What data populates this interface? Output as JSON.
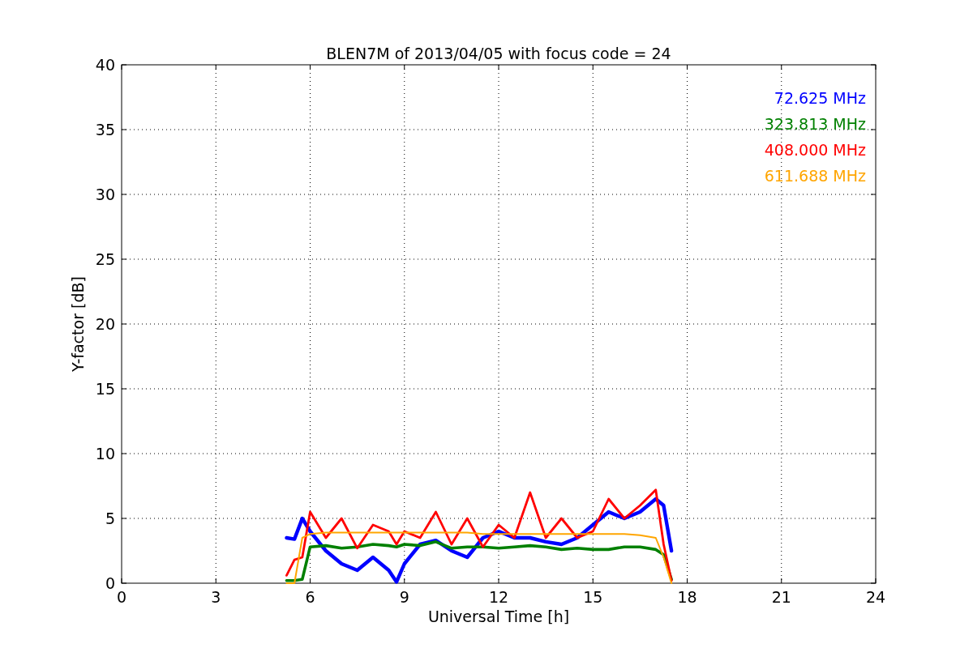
{
  "chart_data": {
    "type": "line",
    "title": "BLEN7M of 2013/04/05 with focus code = 24",
    "xlabel": "Universal Time [h]",
    "ylabel": "Y-factor [dB]",
    "x": [
      5.25,
      5.5,
      5.75,
      6,
      6.5,
      7,
      7.5,
      8,
      8.5,
      8.75,
      9,
      9.5,
      10,
      10.5,
      11,
      11.5,
      12,
      12.5,
      13,
      13.5,
      14,
      14.5,
      15,
      15.5,
      16,
      16.5,
      17,
      17.25,
      17.5
    ],
    "series": [
      {
        "name": "72.625 MHz",
        "color": "#0000ff",
        "values": [
          3.5,
          3.4,
          5.0,
          4.0,
          2.5,
          1.5,
          1.0,
          2.0,
          1.0,
          0.1,
          1.5,
          3.0,
          3.3,
          2.5,
          2.0,
          3.5,
          4.0,
          3.5,
          3.5,
          3.2,
          3.0,
          3.5,
          4.5,
          5.5,
          5.0,
          5.5,
          6.5,
          6.0,
          2.5
        ]
      },
      {
        "name": "323.813 MHz",
        "color": "#008000",
        "values": [
          0.2,
          0.2,
          0.3,
          2.8,
          2.9,
          2.7,
          2.8,
          3.0,
          2.9,
          2.8,
          3.0,
          2.9,
          3.2,
          2.7,
          2.8,
          2.8,
          2.7,
          2.8,
          2.9,
          2.8,
          2.6,
          2.7,
          2.6,
          2.6,
          2.8,
          2.8,
          2.6,
          2.2,
          0.3
        ]
      },
      {
        "name": "408.000 MHz",
        "color": "#ff0000",
        "values": [
          0.6,
          1.8,
          2.0,
          5.5,
          3.5,
          5.0,
          2.7,
          4.5,
          4.0,
          3.0,
          4.0,
          3.5,
          5.5,
          3.0,
          5.0,
          2.8,
          4.5,
          3.5,
          7.0,
          3.5,
          5.0,
          3.5,
          4.0,
          6.5,
          5.0,
          6.0,
          7.2,
          3.0,
          0.2
        ]
      },
      {
        "name": "611.688 MHz",
        "color": "#ffa500",
        "values": [
          0,
          0,
          3.5,
          3.8,
          3.9,
          3.9,
          3.9,
          3.9,
          3.9,
          3.9,
          3.9,
          3.9,
          3.9,
          3.9,
          3.9,
          3.8,
          3.8,
          3.8,
          3.8,
          3.8,
          3.8,
          3.8,
          3.8,
          3.8,
          3.8,
          3.7,
          3.5,
          2.0,
          0
        ]
      }
    ],
    "xlim": [
      0,
      24
    ],
    "ylim": [
      0,
      40
    ],
    "xticks": [
      0,
      3,
      6,
      9,
      12,
      15,
      18,
      21,
      24
    ],
    "yticks": [
      0,
      5,
      10,
      15,
      20,
      25,
      30,
      35,
      40
    ],
    "grid": true
  }
}
